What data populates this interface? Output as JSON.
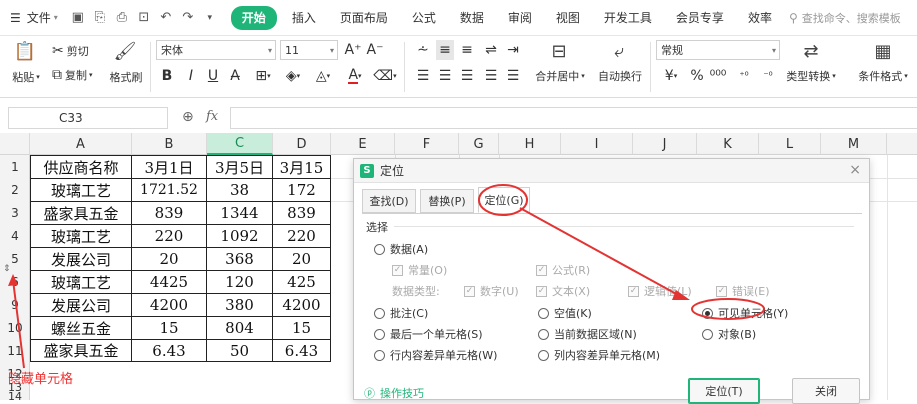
{
  "menubar": {
    "file": "文件",
    "tabs": [
      "开始",
      "插入",
      "页面布局",
      "公式",
      "数据",
      "审阅",
      "视图",
      "开发工具",
      "会员专享",
      "效率"
    ],
    "search_placeholder": "查找命令、搜索模板"
  },
  "ribbon": {
    "paste": "粘贴",
    "cut": "剪切",
    "copy": "复制",
    "format_painter": "格式刷",
    "font_name": "宋体",
    "font_size": "11",
    "merge_center": "合并居中",
    "wrap_text": "自动换行",
    "number_format": "常规",
    "type_convert": "类型转换",
    "conditional_format": "条件格式"
  },
  "formula": {
    "name_box": "C33",
    "fx": "fx"
  },
  "columns": [
    "A",
    "B",
    "C",
    "D",
    "E",
    "F",
    "G",
    "H",
    "I",
    "J",
    "K",
    "L",
    "M"
  ],
  "rows": [
    "1",
    "2",
    "3",
    "4",
    "5",
    "6",
    "9",
    "10",
    "11",
    "12",
    "13",
    "14",
    "15"
  ],
  "table": [
    [
      "供应商名称",
      "3月1日",
      "3月5日",
      "3月15"
    ],
    [
      "玻璃工艺",
      "1721.52",
      "38",
      "172"
    ],
    [
      "盛家具五金",
      "839",
      "1344",
      "839"
    ],
    [
      "玻璃工艺",
      "220",
      "1092",
      "220"
    ],
    [
      "发展公司",
      "20",
      "368",
      "20"
    ],
    [
      "玻璃工艺",
      "4425",
      "120",
      "425"
    ],
    [
      "发展公司",
      "4200",
      "380",
      "4200"
    ],
    [
      "螺丝五金",
      "15",
      "804",
      "15"
    ],
    [
      "盛家具五金",
      "6.43",
      "50",
      "6.43"
    ]
  ],
  "annotation": "隐藏单元格",
  "dialog": {
    "title": "定位",
    "close": "×",
    "tabs": [
      "查找(D)",
      "替换(P)",
      "定位(G)"
    ],
    "group_label": "选择",
    "opt_data": "数据(A)",
    "opt_constant": "常量(O)",
    "opt_formula": "公式(R)",
    "data_type_label": "数据类型:",
    "opt_number": "数字(U)",
    "opt_text": "文本(X)",
    "opt_logic": "逻辑值(L)",
    "opt_error": "错误(E)",
    "opt_comment": "批注(C)",
    "opt_blank": "空值(K)",
    "opt_visible": "可见单元格(Y)",
    "opt_last": "最后一个单元格(S)",
    "opt_region": "当前数据区域(N)",
    "opt_object": "对象(B)",
    "opt_rowdiff": "行内容差异单元格(W)",
    "opt_coldiff": "列内容差异单元格(M)",
    "tips": "操作技巧",
    "ok": "定位(T)",
    "cancel": "关闭"
  },
  "colors": {
    "accent": "#1fb578",
    "annotation": "#e33333"
  }
}
